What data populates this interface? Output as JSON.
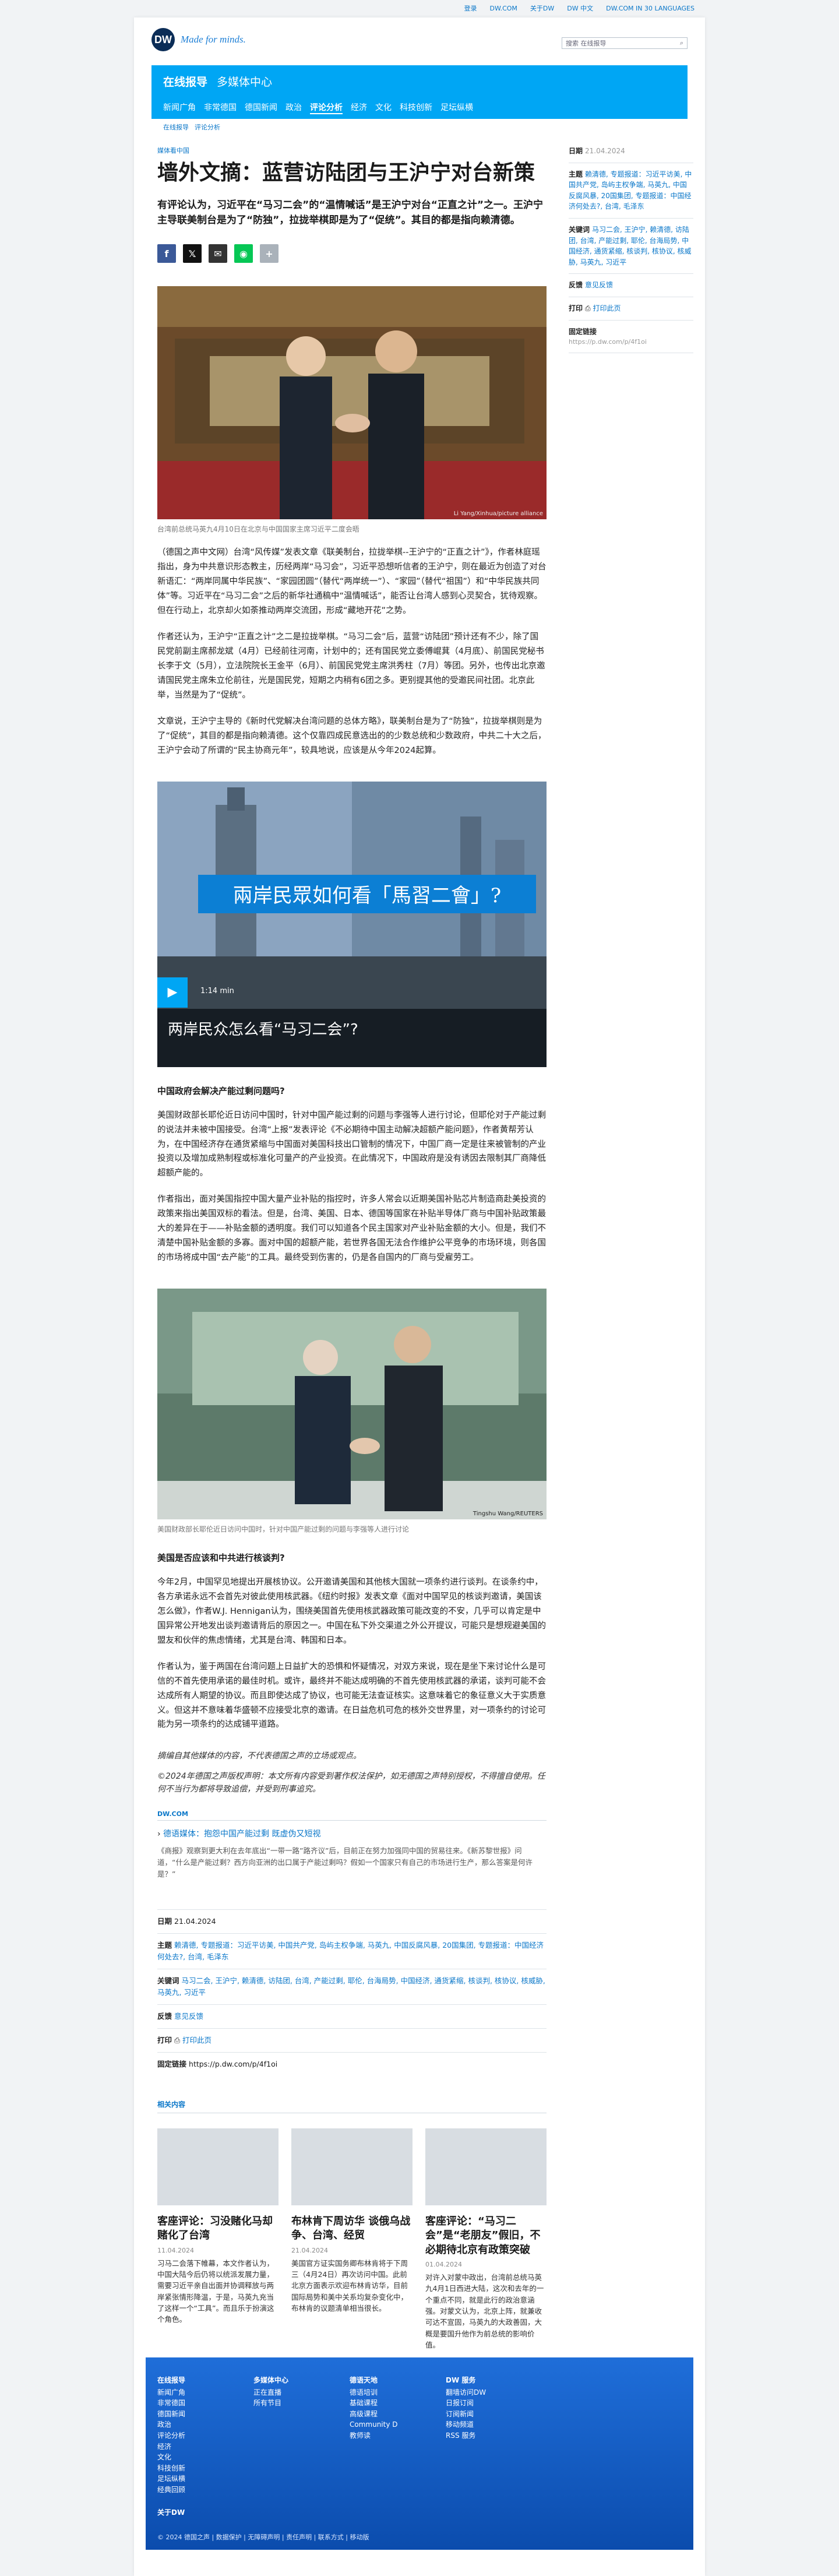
{
  "topbar": {
    "links": [
      "登录",
      "DW.COM",
      "关于DW",
      "DW 中文",
      "DW.COM IN 30 LANGUAGES"
    ]
  },
  "masthead": {
    "logo": "DW",
    "tagline": "Made for minds.",
    "search_placeholder": "搜索 在线报导"
  },
  "nav": {
    "section": "在线报导",
    "subsection": "多媒体中心",
    "items": [
      "新闻广角",
      "非常德国",
      "德国新闻",
      "政治",
      "评论分析",
      "经济",
      "文化",
      "科技创新",
      "足坛纵横"
    ],
    "active": "评论分析"
  },
  "breadcrumb": [
    "在线报导",
    "评论分析"
  ],
  "article": {
    "kicker": "媒体看中国",
    "title": "墙外文摘：蓝营访陆团与王沪宁对台新策",
    "lead": "有评论认为，习近平在“马习二会”的“温情喊话”是王沪宁对台“正直之计”之一。王沪宁主导联美制台是为了“防独”，拉拢举棋即是为了“促统”。其目的都是指向赖清德。",
    "photo_caption": "台湾前总统马英九4月10日在北京与中国国家主席习近平二度会晤",
    "photo_credit": "Li Yang/Xinhua/picture alliance",
    "paragraphs": [
      "（德国之声中文网）台湾“风传媒”发表文章《联美制台，拉拢举棋--王沪宁的“正直之计”》，作者林庭瑶指出，身为中共意识形态教主，历经两岸“马习会”，习近平恐想听信者的王沪宁，则在最近为创造了对台新语汇：“两岸同属中华民族”、“家园团圆”（替代“两岸统一”）、“家园”（替代“祖国”）和“中华民族共同体”等。习近平在“马习二会”之后的新华社通稿中“温情喊话”，能否让台湾人感到心灵契合，犹待观察。但在行动上，北京却火如荼推动两岸交流团，形成“藏地开花”之势。",
      "作者还认为，王沪宁“正直之计”之二是拉拢举棋。“马习二会”后，蓝营“访陆团”预计还有不少，除了国民党前副主席郝龙斌（4月）已经前往河南，计划中的；还有国民党立委傅崐萁（4月底）、前国民党秘书长李于文（5月），立法院院长王金平（6月）、前国民党党主席洪秀柱（7月）等团。另外，也传出北京邀请国民党主席朱立伦前往，光是国民党，短期之内稍有6团之多。更别提其他的受邀民间社团。北京此举，当然是为了“促统”。",
      "文章说，王沪宁主导的《新时代党解决台湾问题的总体方略》，联美制台是为了“防独”，拉拢举棋则是为了“促统”，其目的都是指向赖清德。这个仅靠四成民意选出的的少数总统和少数政府，中共二十大之后，王沪宁会动了所谓的“民主协商元年”，较具地说，应该是从今年2024起算。"
    ],
    "video": {
      "banner": "兩岸民眾如何看「馬習二會」?",
      "duration": "1:14 min",
      "title": "两岸民众怎么看“马习二会”?"
    },
    "section2_title": "中国政府会解决产能过剩问题吗?",
    "section2_paragraphs": [
      "美国财政部长耶伦近日访问中国时，针对中国产能过剩的问题与李强等人进行讨论，但耶伦对于产能过剩的说法并未被中国接受。台湾“上报”发表评论《不必期待中国主动解决超额产能问题》，作者黄帮芳认为，在中国经济存在通货紧缩与中国面对美国科技出口管制的情况下，中国厂商一定是往来被管制的产业投资以及增加成熟制程或标准化可量产的产业投资。在此情况下，中国政府是没有诱因去限制其厂商降低超额产能的。",
      "作者指出，面对美国指控中国大量产业补贴的指控时，许多人常会以近期美国补贴芯片制造商赴美投资的政策来指出美国双标的看法。但是，台湾、美国、日本、德国等国家在补贴半导体厂商与中国补贴政策最大的差异在于——补贴金额的透明度。我们可以知道各个民主国家对产业补贴金额的大小。但是，我们不清楚中国补贴金额的多寡。面对中国的超额产能，若世界各国无法合作维护公平竞争的市场环境，则各国的市场将成中国“去产能”的工具。最终受到伤害的，仍是各自国内的厂商与受雇劳工。"
    ],
    "photo2_caption": "美国财政部长耶伦近日访问中国时，针对中国产能过剩的问题与李强等人进行讨论",
    "photo2_credit": "Tingshu Wang/REUTERS",
    "section3_title": "美国是否应该和中共进行核谈判?",
    "section3_paragraphs": [
      "今年2月，中国罕见地提出开展核协议。公开邀请美国和其他核大国就一项条约进行谈判。在谈条约中，各方承诺永远不会首先对彼此使用核武器。《纽约时报》发表文章《面对中国罕见的核谈判邀请，美国该怎么做》，作者W.J. Hennigan认为，围绕美国首先使用核武器政策可能改变的不安，几乎可以肯定是中国异常公开地发出谈判邀请背后的原因之一。中国在私下外交渠道之外公开提议，可能只是想规避美国的盟友和伙伴的焦虑情绪，尤其是台湾、韩国和日本。",
      "作者认为，鉴于两国在台湾问题上日益扩大的恐惧和怀疑情况，对双方来说，现在是坐下来讨论什么是可信的不首先使用承诺的最佳时机。或许，最终并不能达成明确的不首先使用核武器的承诺，谈判可能不会达成所有人期望的协议。而且即使达成了协议，也可能无法查证核实。这意味着它的象征意义大于实质意义。但这并不意味着华盛顿不应接受北京的邀请。在日益危机可危的核外交世界里，对一项条约的讨论可能为另一项条约的达成铺平道路。"
    ],
    "disclaimer": "摘编自其他媒体的内容，不代表德国之声的立场或观点。",
    "copyright": "©2024年德国之声版权声明：本文所有内容受到著作权法保护，如无德国之声特别授权，不得擅自使用。任何不当行为都将导致追偿，并受到刑事追究。",
    "dw_label": "DW.COM",
    "dw_link": "德语媒体：抱怨中国产能过剩 既虚伪又短视",
    "dw_excerpt": "《商报》观察到更大利在去年底出“一带一路”路齐议”后，目前正在努力加强同中国的贸易往来。《新苏黎世报》问道，“什么是产能过剩？西方向亚洲的出口属于产能过剩吗？假如一个国家只有自己的市场进行生产，那么答案是何许是？”"
  },
  "sidebar": {
    "date_label": "日期",
    "date": "21.04.2024",
    "topics_label": "主题",
    "topics": "赖清德, 专题报道：习近平访美, 中国共产党, 岛屿主权争端, 马英九, 中国反腐风暴, 20国集团, 专题报道：中国经济何处去?, 台湾, 毛泽东",
    "keywords_label": "关键词",
    "keywords": "马习二会, 王沪宁, 赖清德, 访陆团, 台湾, 产能过剩, 耶伦, 台海局势, 中国经济, 通货紧缩, 核谈判, 核协议, 核威胁, 马英九, 习近平",
    "feedback_label": "反馈",
    "feedback": "意见反馈",
    "print_label": "打印",
    "print": "打印此页",
    "permalink_label": "固定链接",
    "permalink": "https://p.dw.com/p/4f1oi"
  },
  "related": {
    "heading": "相关内容",
    "cards": [
      {
        "title": "客座评论：习没赌化马却赌化了台湾",
        "date": "11.04.2024",
        "text": "习马二会落下帷幕，本文作者认为，中国大陆今后仍将以统派发展力量，需要习近平亲自出面并协调释放与两岸紧张情形降温，于是，马英九充当了这样一个“工具”。而且乐于扮演这个角色。"
      },
      {
        "title": "布林肯下周访华 谈俄乌战争、台湾、经贸",
        "date": "21.04.2024",
        "text": "美国官方证实国务卿布林肯将于下周三（4月24日）再次访问中国。此前北京方面表示欢迎布林肯访华，目前国际局势和美中关系均复杂变化中，布林肯的议题清单相当很长。"
      },
      {
        "title": "客座评论：“马习二会”是“老朋友”假旧，不必期待北京有政策突破",
        "date": "01.04.2024",
        "text": "对许入对蒙中政出，台湾前总统马英九4月1日西进大陆，这次和去年的一个重点不同，就是此行的政治意涵强。对蒙文认为，北京上阵，就兼收可达不宣固，马英九的大政善固，大概是要国升他作为前总统的影响价值。"
      }
    ]
  },
  "footer": {
    "cols": [
      {
        "head": "在线报导",
        "items": [
          "新闻广角",
          "非常德国",
          "德国新闻",
          "政治",
          "评论分析",
          "经济",
          "文化",
          "科技创新",
          "足坛纵横",
          "经典回顾"
        ]
      },
      {
        "head": "多媒体中心",
        "items": [
          "正在直播",
          "所有节目"
        ]
      },
      {
        "head": "德语天地",
        "items": [
          "德语培训",
          "基础课程",
          "高级课程",
          "Community D",
          "教师读"
        ]
      },
      {
        "head": "DW 服务",
        "items": [
          "翻墙访问DW",
          "日报订阅",
          "订阅新闻",
          "移动频道",
          "RSS 服务"
        ]
      }
    ],
    "about": "关于DW",
    "bottom": "© 2024 德国之声 | 数据保护 | 无障碍声明 | 责任声明 | 联系方式 | 移动版"
  }
}
